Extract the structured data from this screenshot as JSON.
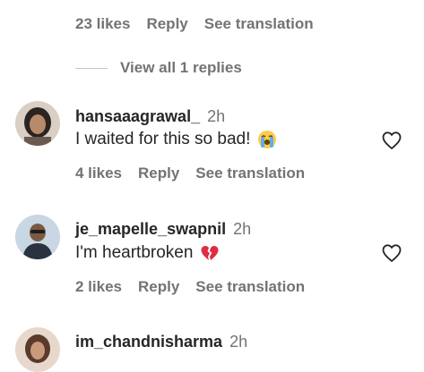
{
  "top_reply": {
    "likes": "23 likes",
    "reply": "Reply",
    "translate": "See translation"
  },
  "view_replies": "View all 1 replies",
  "comments": [
    {
      "username": "hansaaagrawal_",
      "time": "2h",
      "text": "I waited for this so bad!",
      "emoji": "loudly-crying-face",
      "likes": "4 likes",
      "reply": "Reply",
      "translate": "See translation"
    },
    {
      "username": "je_mapelle_swapnil",
      "time": "2h",
      "text": "I'm heartbroken",
      "emoji": "broken-heart",
      "likes": "2 likes",
      "reply": "Reply",
      "translate": "See translation"
    },
    {
      "username": "im_chandnisharma",
      "time": "2h"
    }
  ],
  "colors": {
    "text": "#262626",
    "secondary": "#737373",
    "heart_outline": "#262626",
    "broken_heart": "#e0245e"
  }
}
